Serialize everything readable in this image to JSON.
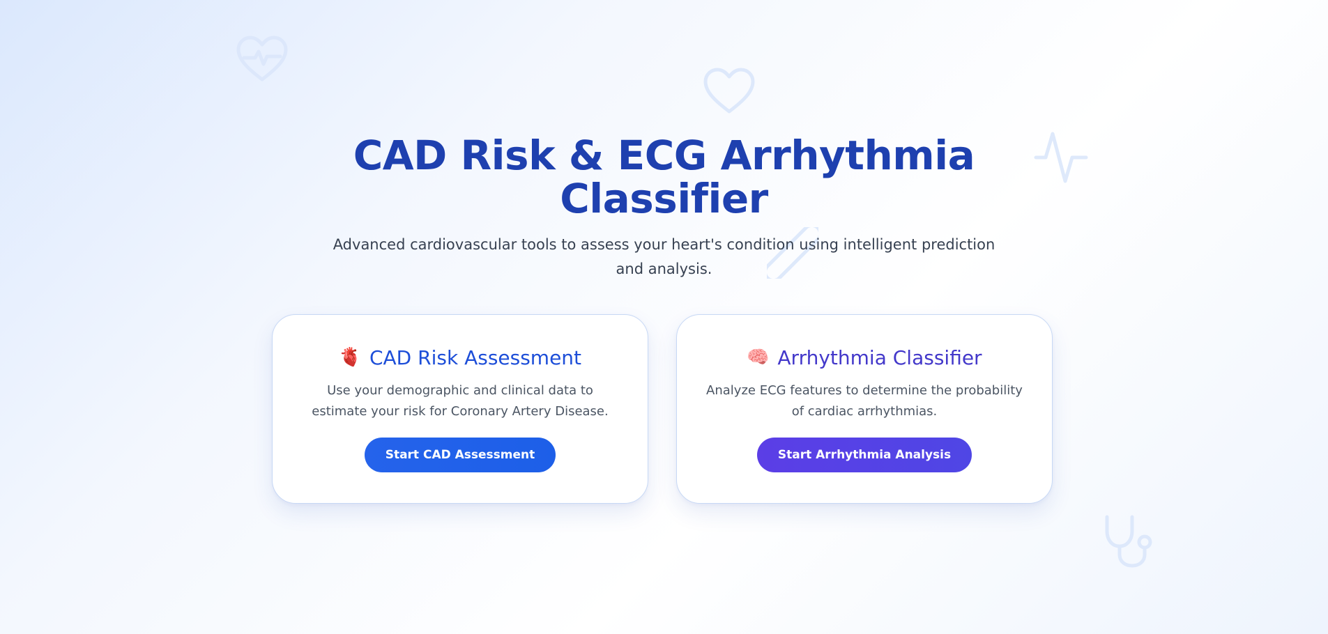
{
  "background": {
    "icons": [
      "heartbeat-icon",
      "heart-icon",
      "pulse-icon",
      "pill-icon",
      "stethoscope-icon"
    ],
    "color": "#dbe7fb"
  },
  "hero": {
    "title": "CAD Risk & ECG Arrhythmia Classifier",
    "subtitle": "Advanced cardiovascular tools to assess your heart's condition using intelligent prediction and analysis."
  },
  "cards": [
    {
      "icon": "anatomical-heart-icon",
      "icon_glyph": "🫀",
      "title": "CAD Risk Assessment",
      "description": "Use your demographic and clinical data to estimate your risk for Coronary Artery Disease.",
      "button_label": "Start CAD Assessment",
      "accent": "#2563eb"
    },
    {
      "icon": "brain-icon",
      "icon_glyph": "🧠",
      "title": "Arrhythmia Classifier",
      "description": "Analyze ECG features to determine the probability of cardiac arrhythmias.",
      "button_label": "Start Arrhythmia Analysis",
      "accent": "#4f46e5"
    }
  ],
  "colors": {
    "title": "#1e40af",
    "subtitle": "#374151",
    "card_border": "#c7d8f5"
  }
}
